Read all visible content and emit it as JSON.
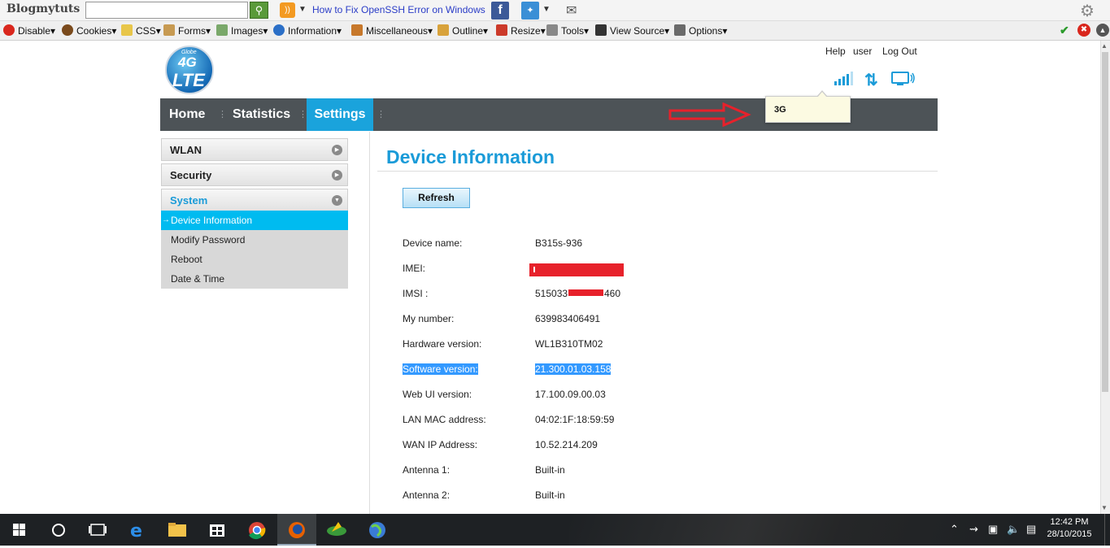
{
  "toolbar": {
    "brand": "Blogmytuts",
    "search_value": "",
    "link_title": "How to Fix OpenSSH Error on Windows"
  },
  "devbar": {
    "items": [
      "Disable",
      "Cookies",
      "CSS",
      "Forms",
      "Images",
      "Information",
      "Miscellaneous",
      "Outline",
      "Resize",
      "Tools",
      "View Source",
      "Options"
    ]
  },
  "header": {
    "logo_top": "Globe",
    "logo_4g": "4G",
    "logo_lte": "LTE",
    "links": [
      "Help",
      "user",
      "Log Out"
    ]
  },
  "nav": {
    "tabs": [
      "Home",
      "Statistics",
      "Settings"
    ],
    "active": "Settings",
    "tooltip": "3G"
  },
  "sidebar": {
    "menus": [
      {
        "label": "WLAN",
        "expanded": false
      },
      {
        "label": "Security",
        "expanded": false
      },
      {
        "label": "System",
        "expanded": true
      }
    ],
    "subitems": [
      "Device Information",
      "Modify Password",
      "Reboot",
      "Date & Time"
    ],
    "active_subitem": "Device Information"
  },
  "content": {
    "title": "Device Information",
    "refresh_label": "Refresh",
    "rows": [
      {
        "label": "Device name:",
        "value": "B315s-936"
      },
      {
        "label": "IMEI:",
        "value": ""
      },
      {
        "label": "IMSI :",
        "value_prefix": "515033",
        "value_suffix": "460"
      },
      {
        "label": "My number:",
        "value": "639983406491"
      },
      {
        "label": "Hardware version:",
        "value": "WL1B310TM02"
      },
      {
        "label": "Software version:",
        "value": "21.300.01.03.158"
      },
      {
        "label": "Web UI version:",
        "value": "17.100.09.00.03"
      },
      {
        "label": "LAN MAC address:",
        "value": "04:02:1F:18:59:59"
      },
      {
        "label": "WAN IP Address:",
        "value": "10.52.214.209"
      },
      {
        "label": "Antenna 1:",
        "value": "Built-in"
      },
      {
        "label": "Antenna 2:",
        "value": "Built-in"
      }
    ]
  },
  "taskbar": {
    "time": "12:42 PM",
    "date": "28/10/2015"
  },
  "colors": {
    "accent": "#1a9bd8",
    "nav_bg": "#4d5357",
    "active_sub": "#00bbf0",
    "redaction": "#e7212b"
  }
}
